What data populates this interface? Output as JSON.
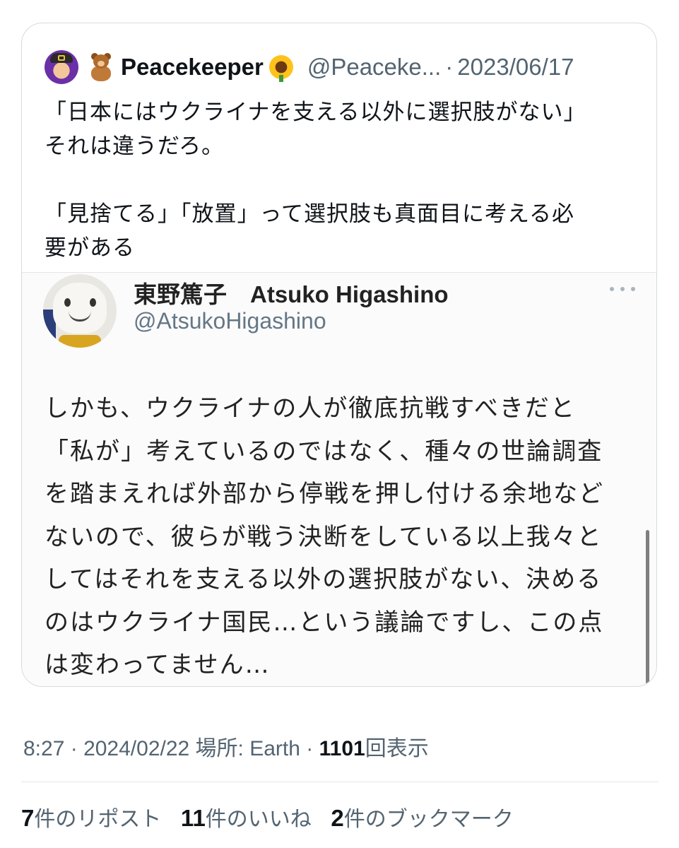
{
  "quoted_tweet": {
    "display_name": "Peacekeeper",
    "handle": "@Peaceke...",
    "separator": "·",
    "date": "2023/06/17",
    "text": "「日本にはウクライナを支える以外に選択肢がない」\nそれは違うだろ。\n\n「見捨てる」「放置」って選択肢も真面目に考える必\n要がある",
    "embedded_image": {
      "name": "東野篤子　Atsuko Higashino",
      "handle": "@AtsukoHigashino",
      "text": "しかも、ウクライナの人が徹底抗戦すべきだと\n「私が」考えているのではなく、種々の世論調査\nを踏まえれば外部から停戦を押し付ける余地など\nないので、彼らが戦う決断をしている以上我々と\nしてはそれを支える以外の選択肢がない、決める\nのはウクライナ国民…という議論ですし、この点\nは変わってません…"
    }
  },
  "meta": {
    "time": "8:27",
    "separator1": " · ",
    "date": "2024/02/22",
    "location": " 場所: Earth",
    "separator2": " · ",
    "views": "1101",
    "views_label": "回表示"
  },
  "stats": {
    "reposts_count": "7",
    "reposts_label": "件のリポスト",
    "likes_count": "11",
    "likes_label": "件のいいね",
    "bookmarks_count": "2",
    "bookmarks_label": "件のブックマーク"
  }
}
